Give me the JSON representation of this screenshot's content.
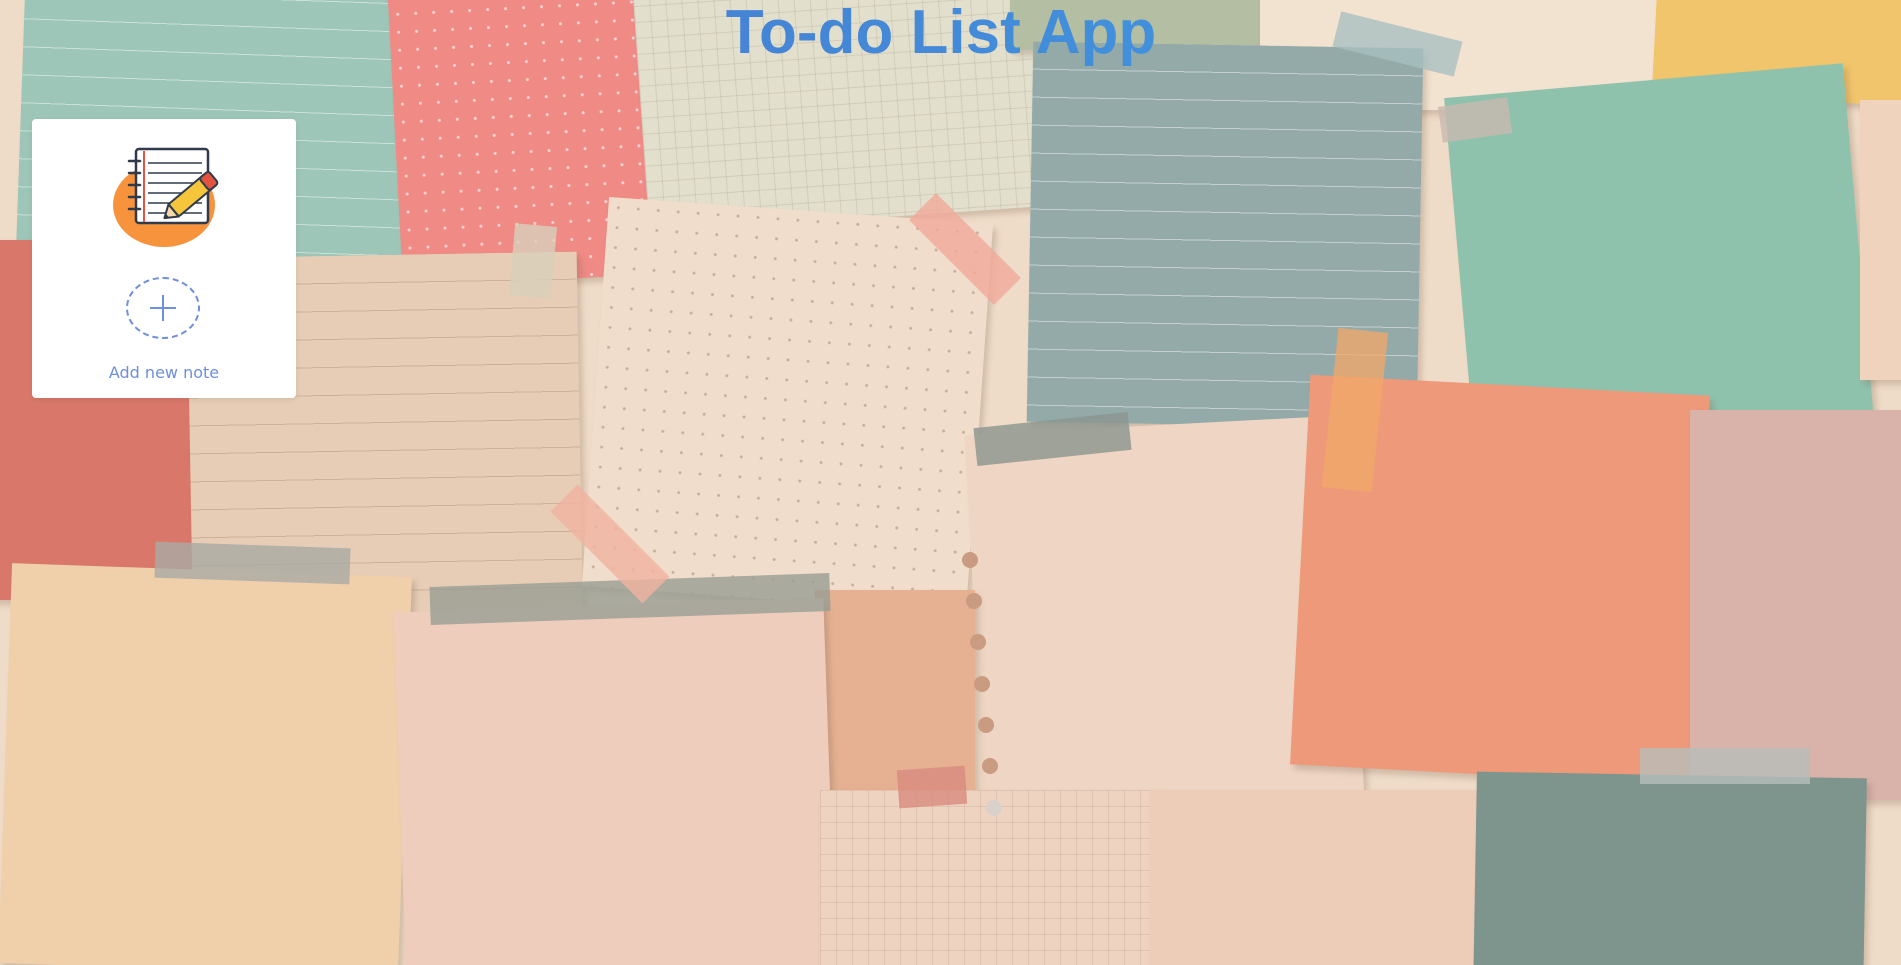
{
  "app": {
    "title": "To-do List App"
  },
  "note_card": {
    "icon": "notebook-pencil-icon",
    "add_icon": "plus-icon",
    "add_label": "Add new note"
  },
  "colors": {
    "title_gradient_start": "#4d6ec9",
    "title_gradient_end": "#3aa6e8",
    "accent": "#6e8fdc",
    "card_background": "#ffffff",
    "icon_circle": "#f7923d"
  }
}
